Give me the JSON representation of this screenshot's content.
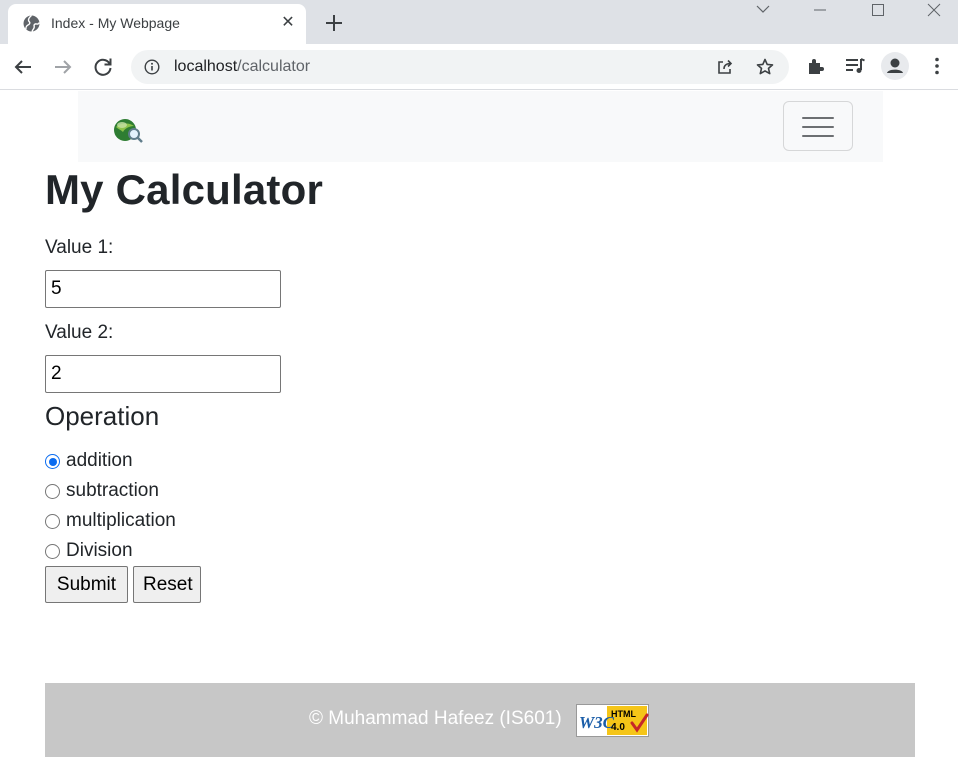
{
  "browser": {
    "tab": {
      "title": "Index - My Webpage",
      "favicon": "globe-icon"
    },
    "address_bar": {
      "host": "localhost",
      "path": "/calculator"
    },
    "icons": [
      "back-arrow-icon",
      "forward-arrow-icon",
      "reload-icon",
      "info-icon",
      "share-icon",
      "star-icon",
      "extensions-icon",
      "media-icon",
      "profile-icon",
      "menu-icon"
    ]
  },
  "navbar": {
    "logo": "site-logo",
    "toggler": "hamburger-menu-icon"
  },
  "calculator": {
    "title": "My Calculator",
    "value1_label": "Value 1:",
    "value1": "5",
    "value2_label": "Value 2:",
    "value2": "2",
    "operation_heading": "Operation",
    "operations": [
      {
        "label": "addition",
        "checked": true
      },
      {
        "label": "subtraction",
        "checked": false
      },
      {
        "label": "multiplication",
        "checked": false
      },
      {
        "label": "Division",
        "checked": false
      }
    ],
    "submit_label": "Submit",
    "reset_label": "Reset"
  },
  "footer": {
    "text": "© Muhammad Hafeez (IS601)",
    "badge_text": "HTML 4.0",
    "badge_brand": "W3C"
  },
  "colors": {
    "radio_accent": "#0b6cf0",
    "footer_bg": "#c7c7c7",
    "chrome_bg": "#dee1e6"
  }
}
